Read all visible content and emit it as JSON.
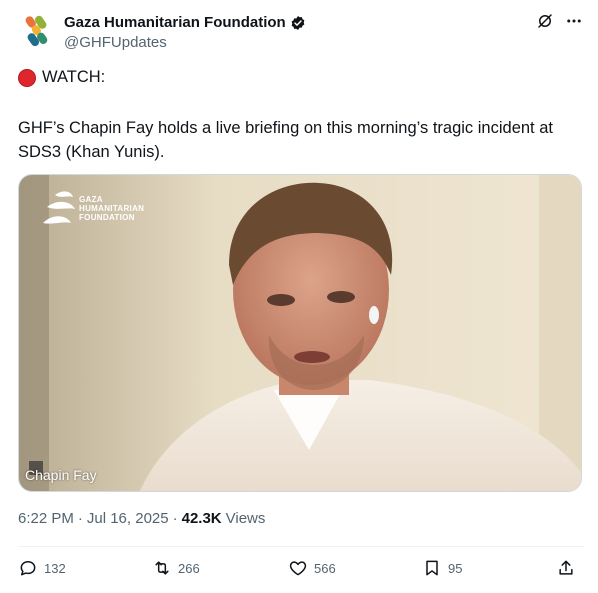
{
  "author": {
    "display_name": "Gaza Humanitarian Foundation",
    "handle": "@GHFUpdates"
  },
  "tweet": {
    "watch_label": "WATCH:",
    "body": "GHF’s Chapin Fay holds a live briefing on this morning’s tragic incident at SDS3 (Khan Yunis)."
  },
  "media": {
    "logo_lines": [
      "GAZA",
      "HUMANITARIAN",
      "FOUNDATION"
    ],
    "speaker_name": "Chapin Fay"
  },
  "meta": {
    "time": "6:22 PM",
    "separator": "·",
    "date": "Jul 16, 2025",
    "separator2": "·",
    "views_count": "42.3K",
    "views_label": "Views"
  },
  "actions": {
    "replies": "132",
    "reposts": "266",
    "likes": "566",
    "bookmarks": "95"
  },
  "colors": {
    "text_primary": "#0f1419",
    "text_secondary": "#536471",
    "red_circle": "#e0262d",
    "verified_badge": "#0f1419"
  },
  "icons": [
    "verified-badge-icon",
    "grok-icon",
    "more-icon",
    "reply-icon",
    "repost-icon",
    "like-icon",
    "bookmark-icon",
    "share-icon"
  ]
}
